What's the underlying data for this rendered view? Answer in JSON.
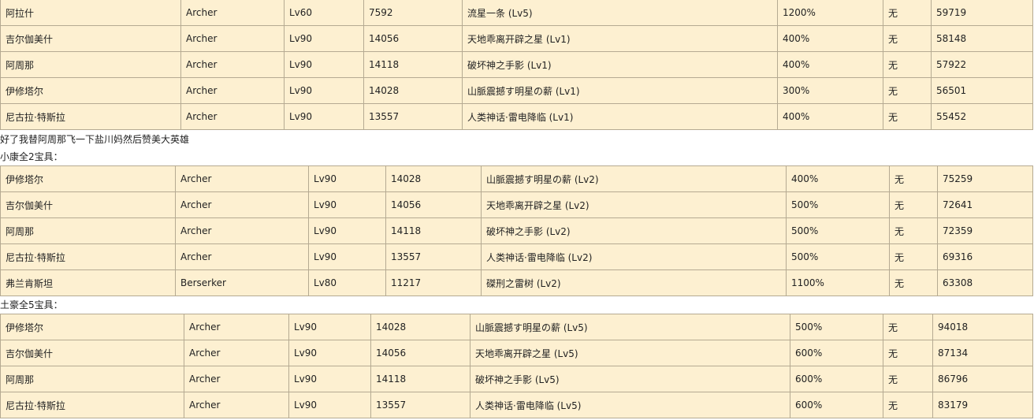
{
  "table1": {
    "rows": [
      [
        "阿拉什",
        "Archer",
        "Lv60",
        "7592",
        "流星一条 (Lv5)",
        "1200%",
        "无",
        "59719"
      ],
      [
        "吉尔伽美什",
        "Archer",
        "Lv90",
        "14056",
        "天地乖离开辟之星 (Lv1)",
        "400%",
        "无",
        "58148"
      ],
      [
        "阿周那",
        "Archer",
        "Lv90",
        "14118",
        "破坏神之手影 (Lv1)",
        "400%",
        "无",
        "57922"
      ],
      [
        "伊修塔尔",
        "Archer",
        "Lv90",
        "14028",
        "山脈震撼す明星の薪 (Lv1)",
        "300%",
        "无",
        "56501"
      ],
      [
        "尼古拉·特斯拉",
        "Archer",
        "Lv90",
        "13557",
        "人类神话·雷电降临 (Lv1)",
        "400%",
        "无",
        "55452"
      ]
    ]
  },
  "note1": "好了我替阿周那飞一下盐川妈然后赞美大英雄",
  "note2": "小康全2宝具：",
  "table2": {
    "rows": [
      [
        "伊修塔尔",
        "Archer",
        "Lv90",
        "14028",
        "山脈震撼す明星の薪 (Lv2)",
        "400%",
        "无",
        "75259"
      ],
      [
        "吉尔伽美什",
        "Archer",
        "Lv90",
        "14056",
        "天地乖离开辟之星 (Lv2)",
        "500%",
        "无",
        "72641"
      ],
      [
        "阿周那",
        "Archer",
        "Lv90",
        "14118",
        "破坏神之手影 (Lv2)",
        "500%",
        "无",
        "72359"
      ],
      [
        "尼古拉·特斯拉",
        "Archer",
        "Lv90",
        "13557",
        "人类神话·雷电降临 (Lv2)",
        "500%",
        "无",
        "69316"
      ],
      [
        "弗兰肯斯坦",
        "Berserker",
        "Lv80",
        "11217",
        "磔刑之雷树 (Lv2)",
        "1100%",
        "无",
        "63308"
      ]
    ]
  },
  "note3": "土豪全5宝具：",
  "table3": {
    "rows": [
      [
        "伊修塔尔",
        "Archer",
        "Lv90",
        "14028",
        "山脈震撼す明星の薪 (Lv5)",
        "500%",
        "无",
        "94018"
      ],
      [
        "吉尔伽美什",
        "Archer",
        "Lv90",
        "14056",
        "天地乖离开辟之星 (Lv5)",
        "600%",
        "无",
        "87134"
      ],
      [
        "阿周那",
        "Archer",
        "Lv90",
        "14118",
        "破坏神之手影 (Lv5)",
        "600%",
        "无",
        "86796"
      ],
      [
        "尼古拉·特斯拉",
        "Archer",
        "Lv90",
        "13557",
        "人类神话·雷电降临 (Lv5)",
        "600%",
        "无",
        "83179"
      ]
    ]
  }
}
